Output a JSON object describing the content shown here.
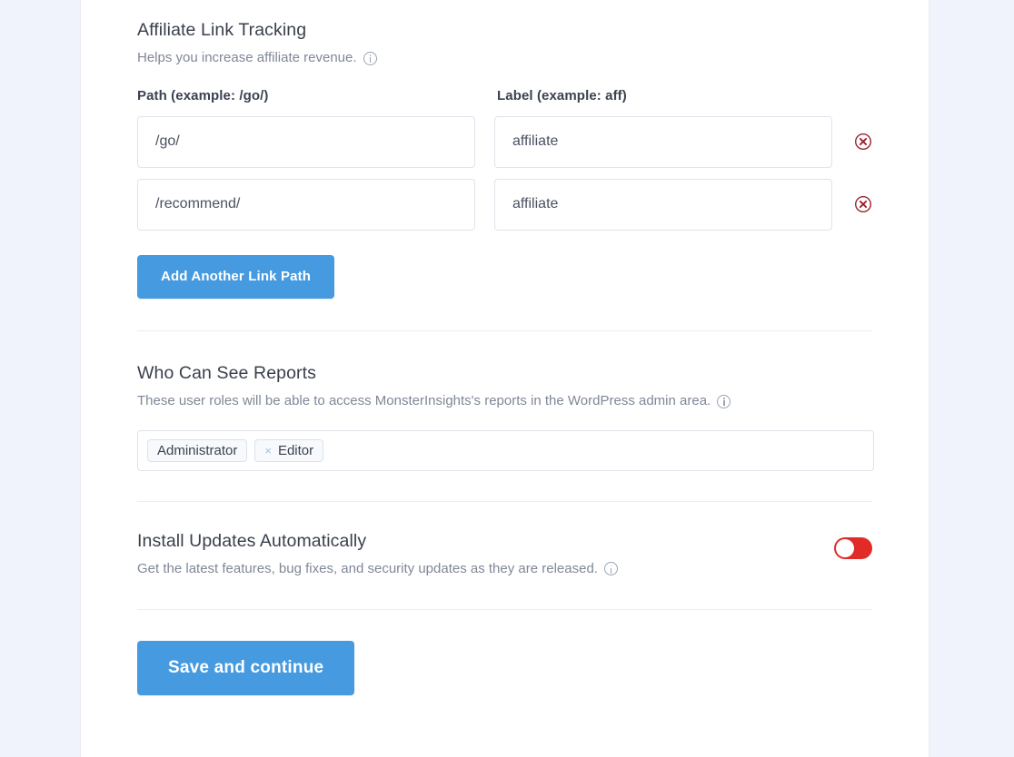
{
  "theme": {
    "page_background": "#f0f3fc",
    "card_background": "#ffffff",
    "accent_blue": "#459ae0",
    "toggle_red": "#e02b27",
    "remove_icon_red": "#9c2231",
    "divider": "#eceef2",
    "heading_color": "#393f4c",
    "muted_text": "#7f8797"
  },
  "affiliate": {
    "title": "Affiliate Link Tracking",
    "description": "Helps you increase affiliate revenue.",
    "info_icon": "info-circle-icon",
    "columns": {
      "path": "Path (example: /go/)",
      "label": "Label (example: aff)"
    },
    "rows": [
      {
        "path_value": "/go/",
        "path_placeholder": "/go/",
        "label_value": "affiliate",
        "label_placeholder": "affiliate",
        "remove_icon": "remove-circle-x-icon"
      },
      {
        "path_value": "/recommend/",
        "path_placeholder": "/go/",
        "label_value": "affiliate",
        "label_placeholder": "affiliate",
        "remove_icon": "remove-circle-x-icon"
      }
    ],
    "add_button_label": "Add Another Link Path"
  },
  "roles": {
    "title": "Who Can See Reports",
    "description": "These user roles will be able to access MonsterInsights's reports in the WordPress admin area.",
    "info_icon": "info-circle-icon",
    "selected": [
      {
        "label": "Administrator",
        "removable": false,
        "remove_glyph": ""
      },
      {
        "label": "Editor",
        "removable": true,
        "remove_glyph": "×"
      }
    ]
  },
  "updates": {
    "title": "Install Updates Automatically",
    "description": "Get the latest features, bug fixes, and security updates as they are released.",
    "info_icon": "info-circle-icon",
    "toggle": {
      "name": "install-updates-toggle",
      "state": "off",
      "color": "#e02b27"
    }
  },
  "footer": {
    "save_label": "Save and continue"
  }
}
